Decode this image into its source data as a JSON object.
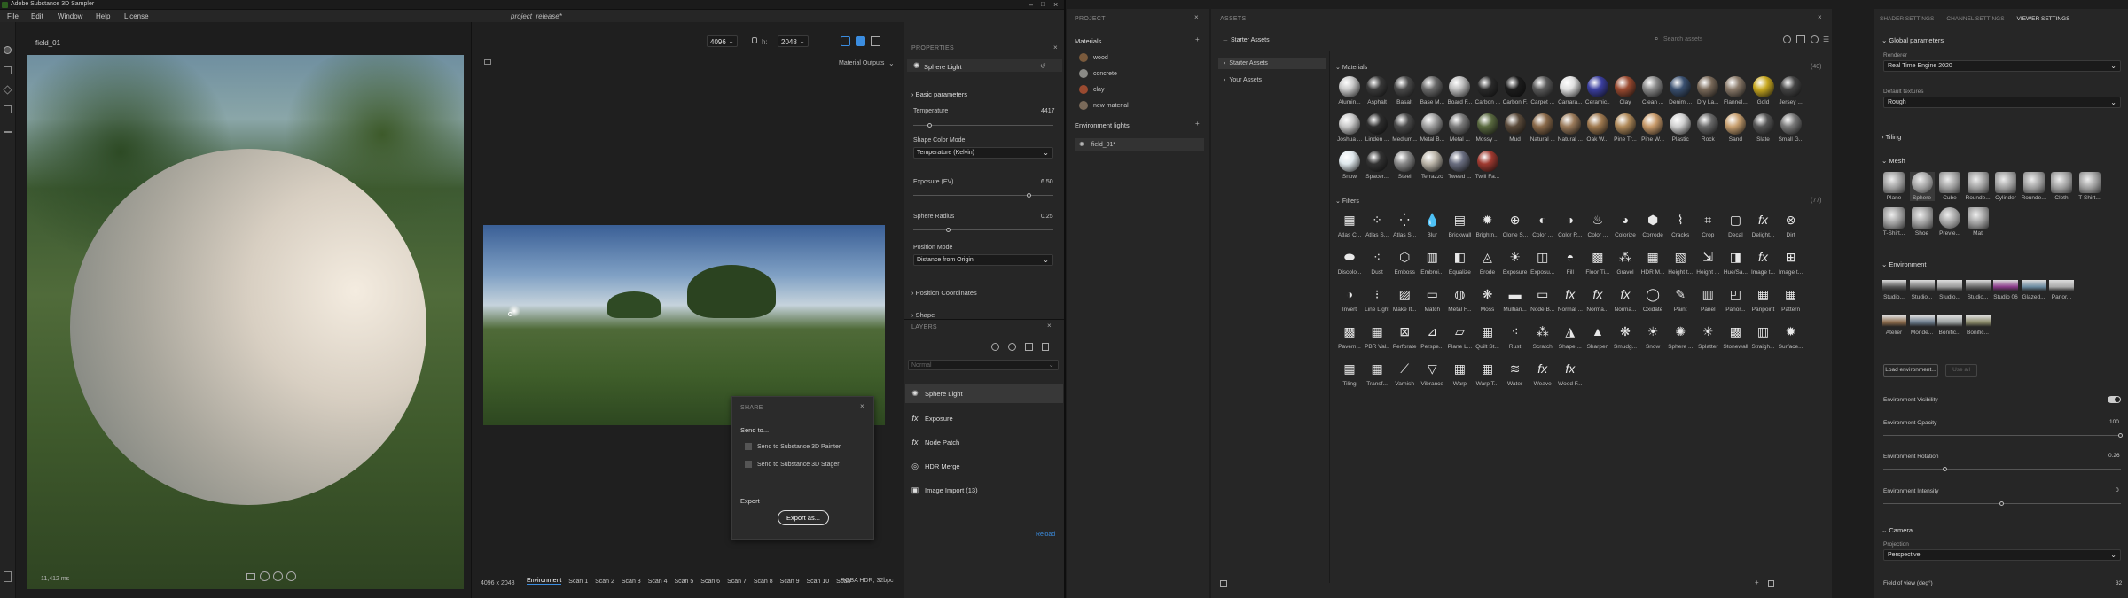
{
  "app": {
    "title": "Adobe Substance 3D Sampler",
    "project": "project_release*",
    "menu": [
      "File",
      "Edit",
      "Window",
      "Help",
      "License"
    ]
  },
  "viewport": {
    "tab": "field_01",
    "res_label_w": "w:",
    "width": "4096",
    "res_label_h": "h:",
    "height": "2048",
    "material_outputs": "Material Outputs",
    "timing": "11,412 ms"
  },
  "view2d": {
    "size": "4096 x 2048",
    "tabs": [
      "Environment",
      "Scan 1",
      "Scan 2",
      "Scan 3",
      "Scan 4",
      "Scan 5",
      "Scan 6",
      "Scan 7",
      "Scan 8",
      "Scan 9",
      "Scan 10",
      "Scan"
    ],
    "format": "RGBA HDR, 32bpc"
  },
  "share": {
    "title": "SHARE",
    "send_to": "Send to...",
    "items": [
      "Send to Substance 3D Painter",
      "Send to Substance 3D Stager"
    ],
    "export_header": "Export",
    "export_button": "Export as..."
  },
  "properties": {
    "header": "PROPERTIES",
    "layer": "Sphere Light",
    "section": "Basic parameters",
    "temp_label": "Temperature",
    "temp_value": "4417",
    "temp_frac": 0.12,
    "shape_mode_label": "Shape Color Mode",
    "shape_mode": "Temperature (Kelvin)",
    "exposure_label": "Exposure (EV)",
    "exposure_value": "6.50",
    "exposure_frac": 0.83,
    "radius_label": "Sphere Radius",
    "radius_value": "0.25",
    "radius_frac": 0.25,
    "position_mode_label": "Position Mode",
    "position_mode": "Distance from Origin",
    "coords": "Position Coordinates",
    "shape": "Shape"
  },
  "layers": {
    "header": "LAYERS",
    "blend": "Normal",
    "items": [
      {
        "name": "Sphere Light",
        "icon": "sun-icon"
      },
      {
        "name": "Exposure",
        "icon": "fx-icon"
      },
      {
        "name": "Node Patch",
        "icon": "fx-icon"
      },
      {
        "name": "HDR Merge",
        "icon": "merge-icon"
      },
      {
        "name": "Image Import (13)",
        "icon": "image-icon"
      }
    ],
    "reload": "Reload"
  },
  "project": {
    "header": "PROJECT",
    "materials_label": "Materials",
    "materials": [
      {
        "name": "wood",
        "color": "#7a5a3c"
      },
      {
        "name": "concrete",
        "color": "#8a8a86"
      },
      {
        "name": "clay",
        "color": "#9a4a30"
      },
      {
        "name": "new material",
        "color": "#7a6a5a"
      }
    ],
    "env_label": "Environment lights",
    "env_items": [
      "field_01*"
    ]
  },
  "assets": {
    "header": "ASSETS",
    "breadcrumb": "Starter Assets",
    "search_placeholder": "Search assets",
    "tree": [
      "Starter Assets",
      "Your Assets"
    ],
    "materials_header": "Materials",
    "materials_count": "(40)",
    "filters_header": "Filters",
    "filters_count": "(77)",
    "materials": [
      "Alumin...",
      "Asphalt",
      "Basalt",
      "Base M...",
      "Board F...",
      "Carbon ...",
      "Carbon F...",
      "Carpet ...",
      "Carrara...",
      "Ceramic...",
      "Clay",
      "Clean ...",
      "Denim ...",
      "Dry La...",
      "Flannel...",
      "Gold",
      "Jersey ...",
      "Joshua ...",
      "Linden ...",
      "Medium...",
      "Metal B...",
      "Metal ...",
      "Mossy ...",
      "Mud",
      "Natural ...",
      "Natural ...",
      "Oak W...",
      "Pine Tr...",
      "Pine W...",
      "Plastic",
      "Rock",
      "Sand",
      "Slate",
      "Small G...",
      "Snow",
      "Spacer...",
      "Steel",
      "Terrazzo",
      "Tweed ...",
      "Twill Fa..."
    ],
    "filters": [
      "Atlas C...",
      "Atlas S...",
      "Atlas S...",
      "Blur",
      "Brickwall",
      "Brightn...",
      "Clone S...",
      "Color ...",
      "Color R...",
      "Color ...",
      "Colorize",
      "Corrode",
      "Cracks",
      "Crop",
      "Decal",
      "Delight...",
      "Dirt",
      "Discolo...",
      "Dust",
      "Emboss",
      "Embroi...",
      "Equalize",
      "Erode",
      "Exposure",
      "Exposu...",
      "Fill",
      "Floor Ti...",
      "Gravel",
      "HDR M...",
      "Height t...",
      "Height ...",
      "Hue/Sa...",
      "Image t...",
      "Image t...",
      "Invert",
      "Line Light",
      "Make It...",
      "Match",
      "Metal F...",
      "Moss",
      "Multian...",
      "Node B...",
      "Normal ...",
      "Norma...",
      "Norma...",
      "Oxidate",
      "Paint",
      "Panel",
      "Panor...",
      "Panpoint",
      "Pattern",
      "Pavem...",
      "PBR Val...",
      "Perforate",
      "Perspe...",
      "Plane L...",
      "Quilt St...",
      "Rust",
      "Scratch",
      "Shape ...",
      "Sharpen",
      "Smudg...",
      "Snow",
      "Sphere ...",
      "Splatter",
      "Stonewall",
      "Straigh...",
      "Surface...",
      "Tiling",
      "Transf...",
      "Varnish",
      "Vibrance",
      "Warp",
      "Warp T...",
      "Water",
      "Weave",
      "Wood F..."
    ]
  },
  "viewer": {
    "tabs": [
      "SHADER SETTINGS",
      "CHANNEL SETTINGS",
      "VIEWER SETTINGS"
    ],
    "global": "Global parameters",
    "renderer_label": "Renderer",
    "renderer": "Real Time Engine 2020",
    "textures_label": "Default textures",
    "textures": "Rough",
    "tiling": "Tiling",
    "mesh": "Mesh",
    "meshes": [
      "Plane",
      "Sphere",
      "Cube",
      "Rounde...",
      "Cylinder",
      "Rounde...",
      "Cloth",
      "T-Shirt...",
      "T-Shirt...",
      "Shoe",
      "Previe...",
      "Mat"
    ],
    "environment": "Environment",
    "envs": [
      "Studio...",
      "Studio...",
      "Studio...",
      "Studio...",
      "Studio 06",
      "Glazed...",
      "Panor...",
      "Atelier",
      "Monde...",
      "Bonific...",
      "Bonific..."
    ],
    "load_env": "Load environment...",
    "use_all": "Use all",
    "visibility": "Environment Visibility",
    "opacity_label": "Environment Opacity",
    "opacity": "100",
    "opacity_frac": 1.0,
    "rotation_label": "Environment Rotation",
    "rotation": "0.26",
    "rotation_frac": 0.26,
    "intensity_label": "Environment Intensity",
    "intensity": "0",
    "intensity_frac": 0.5,
    "camera": "Camera",
    "projection_label": "Projection",
    "projection": "Perspective",
    "fov_label": "Field of view (deg°)",
    "fov": "32"
  }
}
